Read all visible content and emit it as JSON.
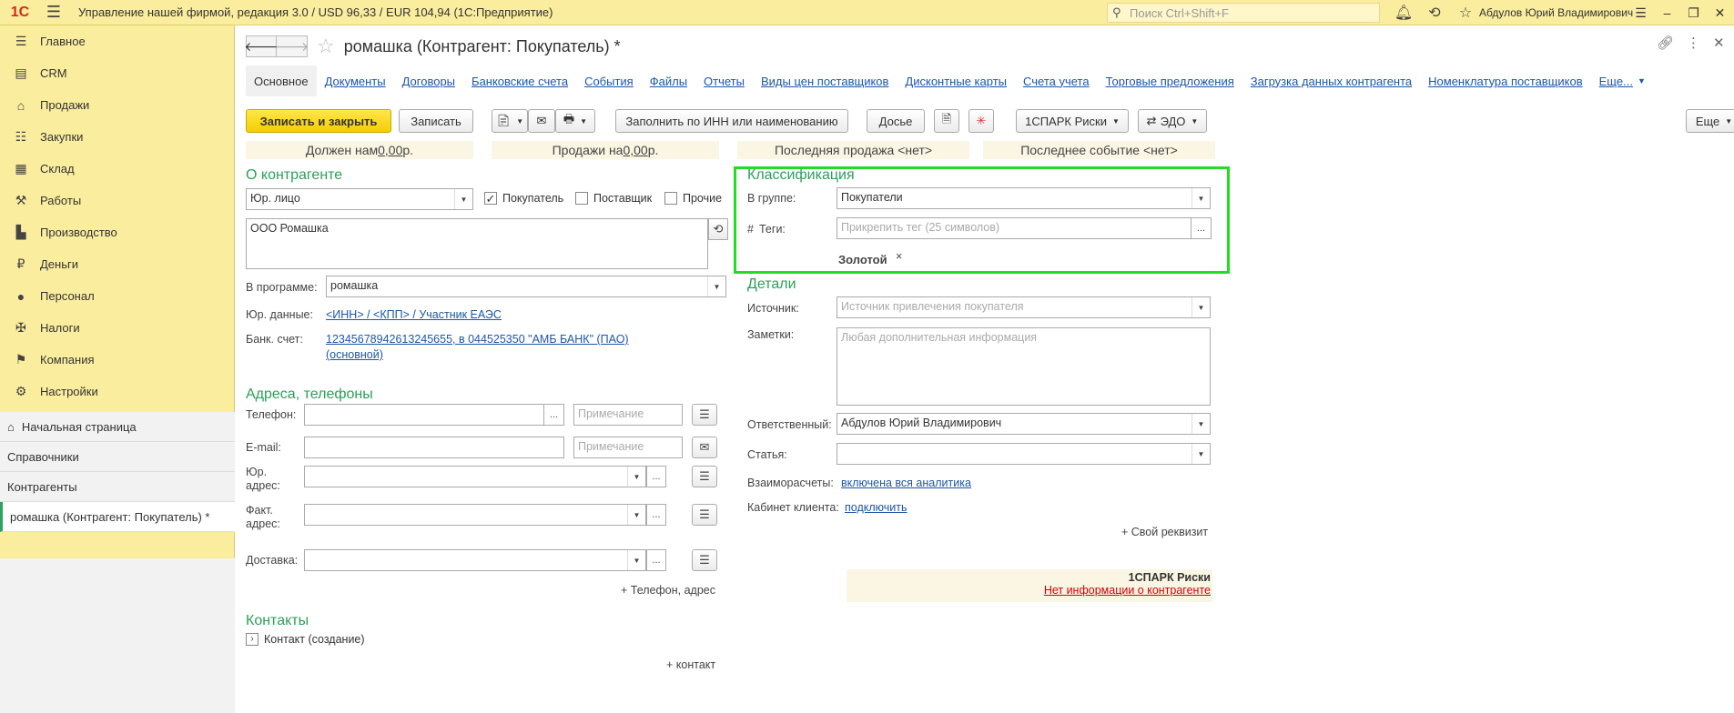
{
  "window": {
    "logo": "1С",
    "title": "Управление нашей фирмой, редакция 3.0 / USD 96,33 / EUR 104,94  (1С:Предприятие)",
    "search_placeholder": "Поиск Ctrl+Shift+F",
    "user": "Абдулов Юрий Владимирович"
  },
  "sidebar": {
    "items": [
      {
        "label": "Главное",
        "icon": "menu-lines-icon"
      },
      {
        "label": "CRM",
        "icon": "crm-card-icon"
      },
      {
        "label": "Продажи",
        "icon": "shop-icon"
      },
      {
        "label": "Закупки",
        "icon": "cart-list-icon"
      },
      {
        "label": "Склад",
        "icon": "grid-icon"
      },
      {
        "label": "Работы",
        "icon": "tools-icon"
      },
      {
        "label": "Производство",
        "icon": "factory-icon"
      },
      {
        "label": "Деньги",
        "icon": "ruble-coin-icon"
      },
      {
        "label": "Персонал",
        "icon": "person-icon"
      },
      {
        "label": "Налоги",
        "icon": "emblem-icon"
      },
      {
        "label": "Компания",
        "icon": "flag-icon"
      },
      {
        "label": "Настройки",
        "icon": "gear-icon"
      }
    ],
    "lower": [
      "Начальная страница",
      "Справочники",
      "Контрагенты",
      "ромашка (Контрагент: Покупатель) *"
    ]
  },
  "form": {
    "title": "ромашка (Контрагент: Покупатель) *",
    "tabs": [
      "Основное",
      "Документы",
      "Договоры",
      "Банковские счета",
      "События",
      "Файлы",
      "Отчеты",
      "Виды цен поставщиков",
      "Дисконтные карты",
      "Счета учета",
      "Торговые предложения",
      "Загрузка данных контрагента",
      "Номенклатура поставщиков",
      "Еще..."
    ],
    "toolbar": {
      "save_close": "Записать и закрыть",
      "save": "Записать",
      "fill_inn": "Заполнить по ИНН или наименованию",
      "dossier": "Досье",
      "spark": "1СПАРК Риски",
      "edo": "ЭДО",
      "more": "Еще"
    },
    "summary": {
      "owes_prefix": "Должен нам ",
      "owes_value": "0,00",
      "owes_suffix": " р.",
      "sales_prefix": "Продажи на ",
      "sales_value": "0,00",
      "sales_suffix": " р.",
      "last_sale": "Последняя продажа <нет>",
      "last_event": "Последнее событие <нет>"
    },
    "about": {
      "header": "О контрагенте",
      "entity_type": "Юр. лицо",
      "chk_buyer": "Покупатель",
      "chk_supplier": "Поставщик",
      "chk_other": "Прочие",
      "name": "ООО Ромашка",
      "program_label": "В программе:",
      "program_value": "ромашка",
      "legal_label": "Юр. данные:",
      "legal_link": "<ИНН> / <КПП> / Участник ЕАЭС",
      "bank_label": "Банк. счет:",
      "bank_link1": "12345678942613245655, в 044525350 \"АМБ БАНК\" (ПАО)",
      "bank_link2": "(основной)"
    },
    "addresses": {
      "header": "Адреса, телефоны",
      "phone_label": "Телефон:",
      "email_label": "E-mail:",
      "legal_addr_label1": "Юр.",
      "legal_addr_label2": "адрес:",
      "fact_addr_label1": "Факт.",
      "fact_addr_label2": "адрес:",
      "delivery_label": "Доставка:",
      "note_placeholder": "Примечание",
      "add_phone": "+ Телефон, адрес"
    },
    "contacts": {
      "header": "Контакты",
      "contact_create": "Контакт (создание)",
      "add_contact": "+ контакт"
    },
    "classification": {
      "header": "Классификация",
      "group_label": "В группе:",
      "group_value": "Покупатели",
      "tags_label": "Теги:",
      "tags_hash": "#",
      "tags_placeholder": "Прикрепить тег (25 символов)",
      "tag": "Золотой",
      "tag_remove": "×"
    },
    "details": {
      "header": "Детали",
      "source_label": "Источник:",
      "source_placeholder": "Источник привлечения покупателя",
      "notes_label": "Заметки:",
      "notes_placeholder": "Любая дополнительная информация",
      "responsible_label": "Ответственный:",
      "responsible_value": "Абдулов Юрий Владимирович",
      "article_label": "Статья:",
      "settlements_label": "Взаиморасчеты:",
      "settlements_link": "включена вся аналитика",
      "cabinet_label": "Кабинет клиента:",
      "cabinet_link": "подключить",
      "add_requisite": "+ Свой реквизит"
    },
    "spark": {
      "title": "1СПАРК Риски",
      "no_info": "Нет информации о контрагенте"
    }
  }
}
